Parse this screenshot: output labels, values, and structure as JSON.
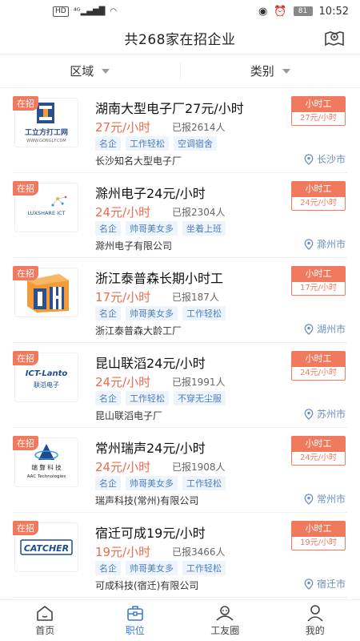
{
  "status": {
    "left": "HD 4G",
    "battery": "81",
    "time": "10:52"
  },
  "header": {
    "title": "共268家在招企业"
  },
  "filters": [
    {
      "label": "区域"
    },
    {
      "label": "类别"
    }
  ],
  "jobs": [
    {
      "badge": "在招",
      "title": "湖南大型电子厂27元/小时",
      "wage": "27元/小时",
      "applied": "已报2614人",
      "tags": [
        "名企",
        "工作轻松",
        "空调宿舍"
      ],
      "company": "长沙知名大型电子厂",
      "type": "小时工",
      "type_wage": "27元/小时",
      "city": "长沙市",
      "logo_text": "工立方打工网",
      "logo_sub": "WWW.GONGLF.COM"
    },
    {
      "badge": "在招",
      "title": "滁州电子24元/小时",
      "wage": "24元/小时",
      "applied": "已报2304人",
      "tags": [
        "名企",
        "帅哥美女多",
        "坐着上班"
      ],
      "company": "滁州电子有限公司",
      "type": "小时工",
      "type_wage": "24元/小时",
      "city": "滁州市",
      "logo_text": "LUXSHARE ICT"
    },
    {
      "badge": "在招",
      "title": "浙江泰普森长期小时工",
      "wage": "17元/小时",
      "applied": "已报187人",
      "tags": [
        "名企",
        "帅哥美女多",
        "工作轻松"
      ],
      "company": "浙江泰普森大龄工厂",
      "type": "小时工",
      "type_wage": "17元/小时",
      "city": "湖州市",
      "logo_text": "IH"
    },
    {
      "badge": "在招",
      "title": "昆山联滔24元/小时",
      "wage": "24元/小时",
      "applied": "已报1991人",
      "tags": [
        "名企",
        "工作轻松",
        "不穿无尘服"
      ],
      "company": "昆山联滔电子厂",
      "type": "小时工",
      "type_wage": "24元/小时",
      "city": "苏州市",
      "logo_text": "ICT-Lanto",
      "logo_sub": "联滔电子"
    },
    {
      "badge": "在招",
      "title": "常州瑞声24元/小时",
      "wage": "24元/小时",
      "applied": "已报1908人",
      "tags": [
        "名企",
        "帅哥美女多",
        "工作轻松"
      ],
      "company": "瑞声科技(常州)有限公司",
      "type": "小时工",
      "type_wage": "24元/小时",
      "city": "常州市",
      "logo_text": "瑞 聲 科 技",
      "logo_sub": "AAC Technologies"
    },
    {
      "badge": "在招",
      "title": "宿迁可成19元/小时",
      "wage": "19元/小时",
      "applied": "已报3466人",
      "tags": [
        "名企",
        "帅哥美女多",
        "工作轻松"
      ],
      "company": "可成科技(宿迁)有限公司",
      "type": "小时工",
      "type_wage": "19元/小时",
      "city": "宿迁市",
      "logo_text": "CATCHER"
    }
  ],
  "tabs": [
    {
      "label": "首页",
      "icon": "home-icon"
    },
    {
      "label": "职位",
      "icon": "briefcase-icon"
    },
    {
      "label": "工友圈",
      "icon": "community-icon"
    },
    {
      "label": "我的",
      "icon": "user-icon"
    }
  ],
  "colors": {
    "accent": "#f07a5e",
    "tab_active": "#3a7bd5",
    "tag_bg": "#eef4fb",
    "tag_text": "#4a7fc1"
  }
}
